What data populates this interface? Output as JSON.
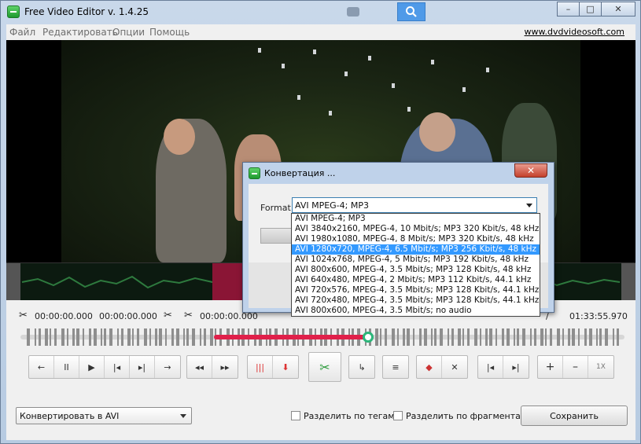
{
  "window": {
    "title": "Free Video Editor v. 1.4.25"
  },
  "titlebar": {
    "cam_text": "◎",
    "controls": [
      "–",
      "□",
      "✕"
    ]
  },
  "menu": {
    "items": [
      "Файл",
      "Редактировать",
      "Опции",
      "Помощь"
    ],
    "site": "www.dvdvideosoft.com"
  },
  "timeline": {
    "t1": "00:00:00.000",
    "t2": "00:00:00.000",
    "t3": "00:00:00.000",
    "t_end": "01:33:55.970",
    "selection_start_fraction": 0.32,
    "selection_end_fraction": 0.575
  },
  "controls": {
    "group1": [
      "←",
      "II",
      "▶",
      "|◂",
      "▸|",
      "→"
    ],
    "group2": [
      "◂◂",
      "▸▸"
    ],
    "group3": [
      "|||",
      "⬇"
    ],
    "group5": [
      "↳"
    ],
    "group6": [
      "≡"
    ],
    "group7": [
      "◆",
      "✕"
    ],
    "group8": [
      "|◂",
      "▸|"
    ],
    "group9": [
      "+",
      "–",
      "1X"
    ]
  },
  "bottom": {
    "convert_select": "Конвертировать в AVI",
    "split_tags": "Разделить по тегам",
    "split_fragments": "Разделить по фрагментам",
    "save": "Сохранить"
  },
  "dialog": {
    "title": "Конвертация ...",
    "format_label": "Format",
    "selected_format": "AVI MPEG-4; MP3",
    "options": [
      "AVI MPEG-4; MP3",
      "AVI 3840x2160, MPEG-4, 10 Mbit/s; MP3 320 Kbit/s, 48 kHz",
      "AVI 1980x1080, MPEG-4, 8 Mbit/s; MP3 320 Kbit/s, 48 kHz",
      "AVI 1280x720, MPEG-4, 6.5 Mbit/s; MP3 256 Kbit/s, 48 kHz",
      "AVI 1024x768, MPEG-4, 5 Mbit/s; MP3 192 Kbit/s, 48 kHz",
      "AVI 800x600, MPEG-4, 3.5 Mbit/s; MP3 128 Kbit/s, 48 kHz",
      "AVI 640x480, MPEG-4, 2 Mbit/s; MP3 112 Kbit/s, 44.1 kHz",
      "AVI 720x576, MPEG-4, 3.5 Mbit/s; MP3 128 Kbit/s, 44.1 kHz",
      "AVI 720x480, MPEG-4, 3.5 Mbit/s; MP3 128 Kbit/s, 44.1 kHz",
      "AVI 800x600, MPEG-4, 3.5 Mbit/s; no audio"
    ],
    "highlighted_index": 3
  },
  "colors": {
    "accent_selection": "#e0204a",
    "handle": "#2cb67a",
    "highlight": "#3399ff"
  }
}
